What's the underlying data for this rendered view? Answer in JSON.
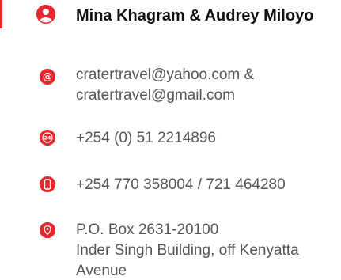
{
  "contact": {
    "name": "Mina Khagram & Audrey Miloyo",
    "email_line1": "cratertravel@yahoo.com &",
    "email_line2": "cratertravel@gmail.com",
    "phone_landline": "+254 (0) 51 2214896",
    "phone_mobile": "+254 770 358004 / 721 464280",
    "address_line1": "P.O. Box 2631-20100",
    "address_line2": "Inder Singh Building, off Kenyatta",
    "address_line3": "Avenue"
  },
  "icons": {
    "person": "user-icon",
    "email": "at-sign-icon",
    "landline": "phone-24h-icon",
    "mobile": "mobile-phone-icon",
    "address": "location-pin-icon"
  },
  "colors": {
    "accent": "#e8262d",
    "title_text": "#111111",
    "body_text": "#555555"
  }
}
